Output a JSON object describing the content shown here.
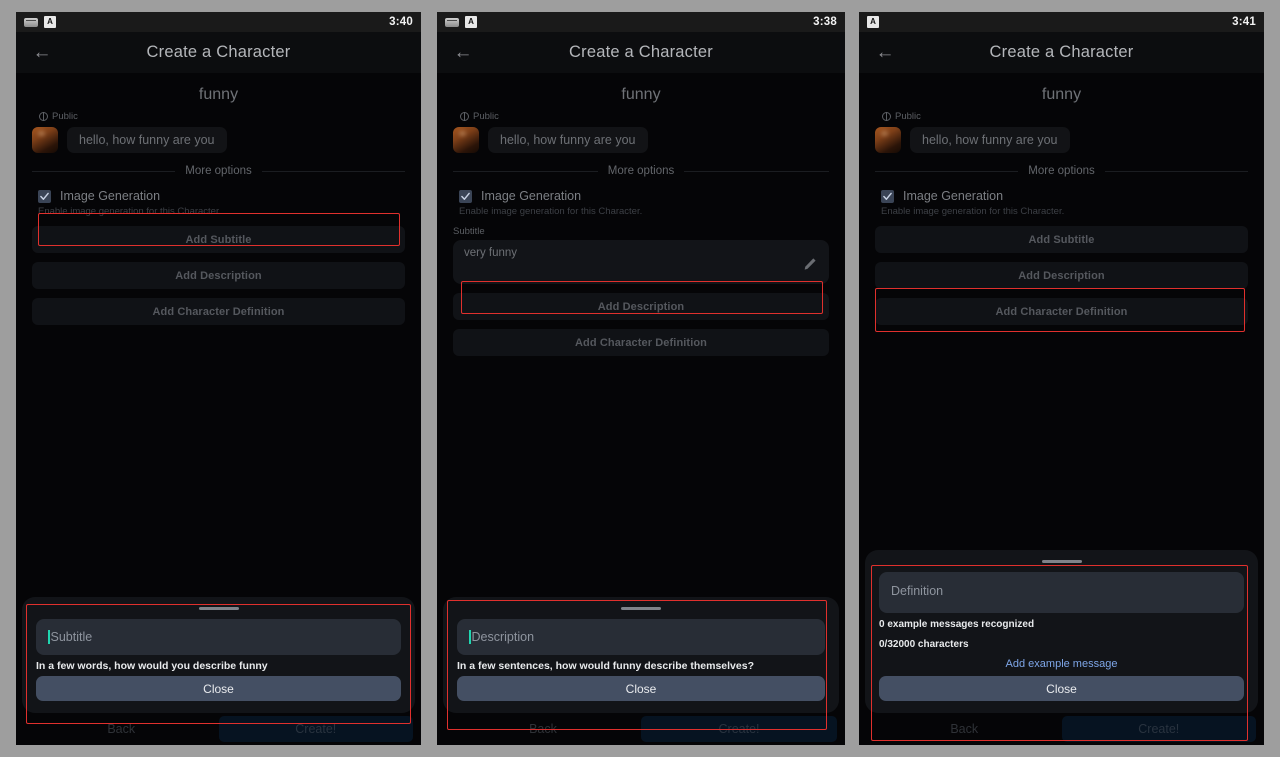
{
  "panels": [
    {
      "statusbar": {
        "clock": "3:40",
        "icons": [
          "keyboard-icon",
          "app-icon"
        ]
      },
      "appbar": {
        "back": "back-arrow-icon",
        "title": "Create a Character"
      },
      "character": {
        "name": "funny",
        "visibility": "Public",
        "greeting": "hello, how funny are you"
      },
      "divider_label": "More options",
      "image_generation": {
        "label": "Image Generation",
        "description": "Enable image generation for this Character.",
        "checked": true
      },
      "option_buttons": [
        "Add Subtitle",
        "Add Description",
        "Add Character Definition"
      ],
      "sheet": {
        "input_placeholder": "Subtitle",
        "hint": "In a few words, how would you describe funny",
        "close_label": "Close"
      },
      "bottom": {
        "back": "Back",
        "create": "Create!"
      }
    },
    {
      "statusbar": {
        "clock": "3:38",
        "icons": [
          "keyboard-icon",
          "app-icon"
        ]
      },
      "appbar": {
        "back": "back-arrow-icon",
        "title": "Create a Character"
      },
      "character": {
        "name": "funny",
        "visibility": "Public",
        "greeting": "hello, how funny are you"
      },
      "divider_label": "More options",
      "image_generation": {
        "label": "Image Generation",
        "description": "Enable image generation for this Character.",
        "checked": true
      },
      "subtitle_field": {
        "label": "Subtitle",
        "value": "very funny"
      },
      "option_buttons": [
        "Add Description",
        "Add Character Definition"
      ],
      "sheet": {
        "input_placeholder": "Description",
        "hint": "In a few sentences, how would funny describe themselves?",
        "close_label": "Close"
      },
      "bottom": {
        "back": "Back",
        "create": "Create!"
      }
    },
    {
      "statusbar": {
        "clock": "3:41",
        "icons": [
          "app-icon"
        ]
      },
      "appbar": {
        "back": "back-arrow-icon",
        "title": "Create a Character"
      },
      "character": {
        "name": "funny",
        "visibility": "Public",
        "greeting": "hello, how funny are you"
      },
      "divider_label": "More options",
      "image_generation": {
        "label": "Image Generation",
        "description": "Enable image generation for this Character.",
        "checked": true
      },
      "option_buttons": [
        "Add Subtitle",
        "Add Description",
        "Add Character Definition"
      ],
      "sheet": {
        "input_placeholder": "Definition",
        "examples_recognized": "0 example messages recognized",
        "character_count": "0/32000 characters",
        "add_example_label": "Add example message",
        "close_label": "Close"
      },
      "bottom": {
        "back": "Back",
        "create": "Create!"
      }
    }
  ],
  "colors": {
    "highlight": "#e0302d",
    "accent_caret": "#1fd6b0",
    "close_button": "#444f63",
    "link": "#7ea6e8",
    "page_background": "#9e9e9e"
  }
}
